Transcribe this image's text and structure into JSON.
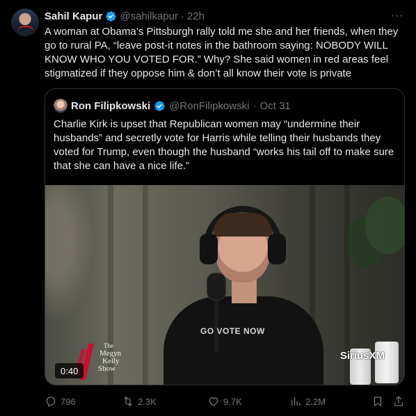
{
  "tweet": {
    "author_name": "Sahil Kapur",
    "author_handle": "@sahilkapur",
    "separator": "·",
    "time": "22h",
    "more": "···",
    "text": "A woman at Obama’s Pittsburgh rally told me she and her friends, when they go to rural PA, “leave post-it notes in the bathroom saying: NOBODY WILL KNOW WHO YOU VOTED FOR.” Why? She said women in red areas feel stigmatized if they oppose him & don’t all know their vote is private"
  },
  "quote": {
    "author_name": "Ron Filipkowski",
    "author_handle": "@RonFilipkowski",
    "separator": "·",
    "date": "Oct 31",
    "text": "Charlie Kirk is upset that Republican women may “undermine their husbands” and secretly vote for Harris while telling their husbands they voted for Trump, even though the husband “works his tail off to make sure that she can have a nice life.”",
    "video": {
      "duration": "0:40",
      "shirt_text": "GO VOTE NOW",
      "brand_logo": "SiriusXM",
      "show_logo_line1": "The",
      "show_logo_line2": "Megyn",
      "show_logo_line3": "Kelly",
      "show_logo_line4": "Show"
    }
  },
  "actions": {
    "replies": "796",
    "retweets": "2.3K",
    "likes": "9.7K",
    "views": "2.2M"
  },
  "colors": {
    "background": "#000000",
    "text": "#e7e9ea",
    "muted": "#71767b",
    "verified": "#1d9bf0",
    "border": "#2f3336"
  },
  "icons": [
    "verified-badge-icon",
    "more-icon",
    "reply-icon",
    "retweet-icon",
    "like-icon",
    "views-icon",
    "bookmark-icon",
    "share-icon"
  ]
}
